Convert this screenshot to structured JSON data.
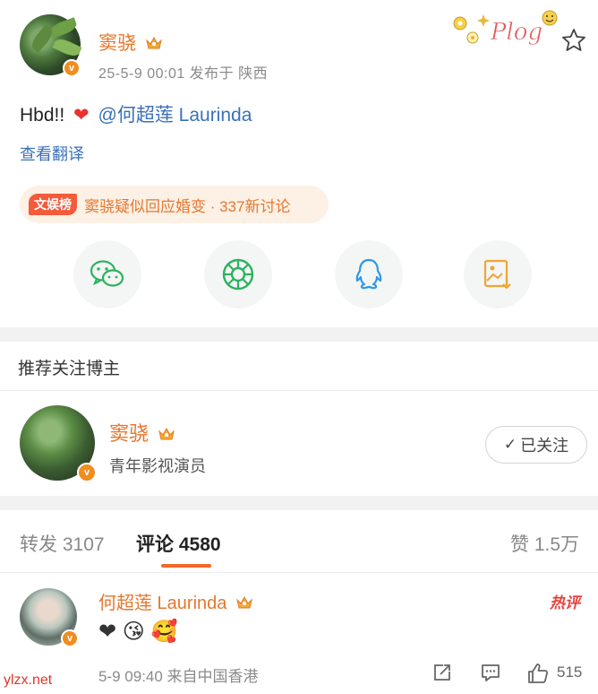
{
  "post": {
    "author": "窦骁",
    "meta": "25-5-9 00:01  发布于 陕西",
    "text_prefix": "Hbd!!",
    "heart": "❤",
    "mention": "@何超莲 Laurinda",
    "translate_link": "查看翻译",
    "sticker_text": "Plog",
    "hot_topic": {
      "tag": "文娱榜",
      "text": "窦骁疑似回应婚变 · 337新讨论"
    },
    "share_icons": [
      "wechat-icon",
      "moments-icon",
      "qq-icon",
      "save-image-icon"
    ]
  },
  "recommend": {
    "title": "推荐关注博主",
    "name": "窦骁",
    "description": "青年影视演员",
    "follow_label": "已关注"
  },
  "tabs": {
    "repost": "转发 3107",
    "comments": "评论 4580",
    "likes": "赞 1.5万"
  },
  "comment": {
    "author": "何超莲 Laurinda",
    "hot_label": "热评",
    "body": "❤ 😘 🥰",
    "meta": "5-9 09:40  来自中国香港",
    "like_count": "515"
  },
  "watermark": "ylzx.net",
  "colors": {
    "accent_orange": "#e5772e",
    "link_blue": "#3a71b8",
    "hot_red": "#e3453f",
    "tab_underline": "#f26a28"
  }
}
